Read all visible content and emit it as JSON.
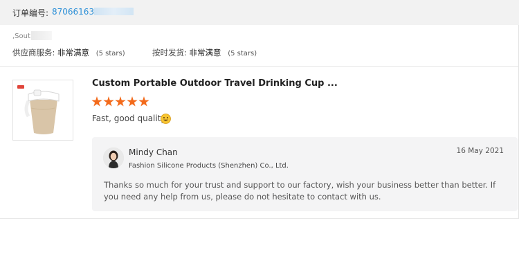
{
  "order": {
    "label": "订单编号:",
    "number": "870661630"
  },
  "buyer": {
    "location": ",Sout"
  },
  "ratings": {
    "service": {
      "label": "供应商服务:",
      "value": "非常满意",
      "stars": "(5 stars)"
    },
    "shipping": {
      "label": "按时发货:",
      "value": "非常满意",
      "stars": "(5 stars)"
    }
  },
  "review": {
    "product_title": "Custom Portable Outdoor Travel Drinking Cup ...",
    "star_count": 5,
    "star_color": "#f36a1b",
    "text": "Fast, good quality",
    "emoji": "smiling-face-icon"
  },
  "reply": {
    "name": "Mindy Chan",
    "company": "Fashion Silicone Products (Shenzhen) Co., Ltd.",
    "date": "16 May 2021",
    "text": "Thanks so much for your trust and support to our factory, wish your business better than better. If you need any help from us, please do not hesitate to contact with us."
  },
  "colors": {
    "link": "#2b8fd7",
    "header_bg": "#f2f2f2",
    "reply_bg": "#f4f4f5"
  }
}
